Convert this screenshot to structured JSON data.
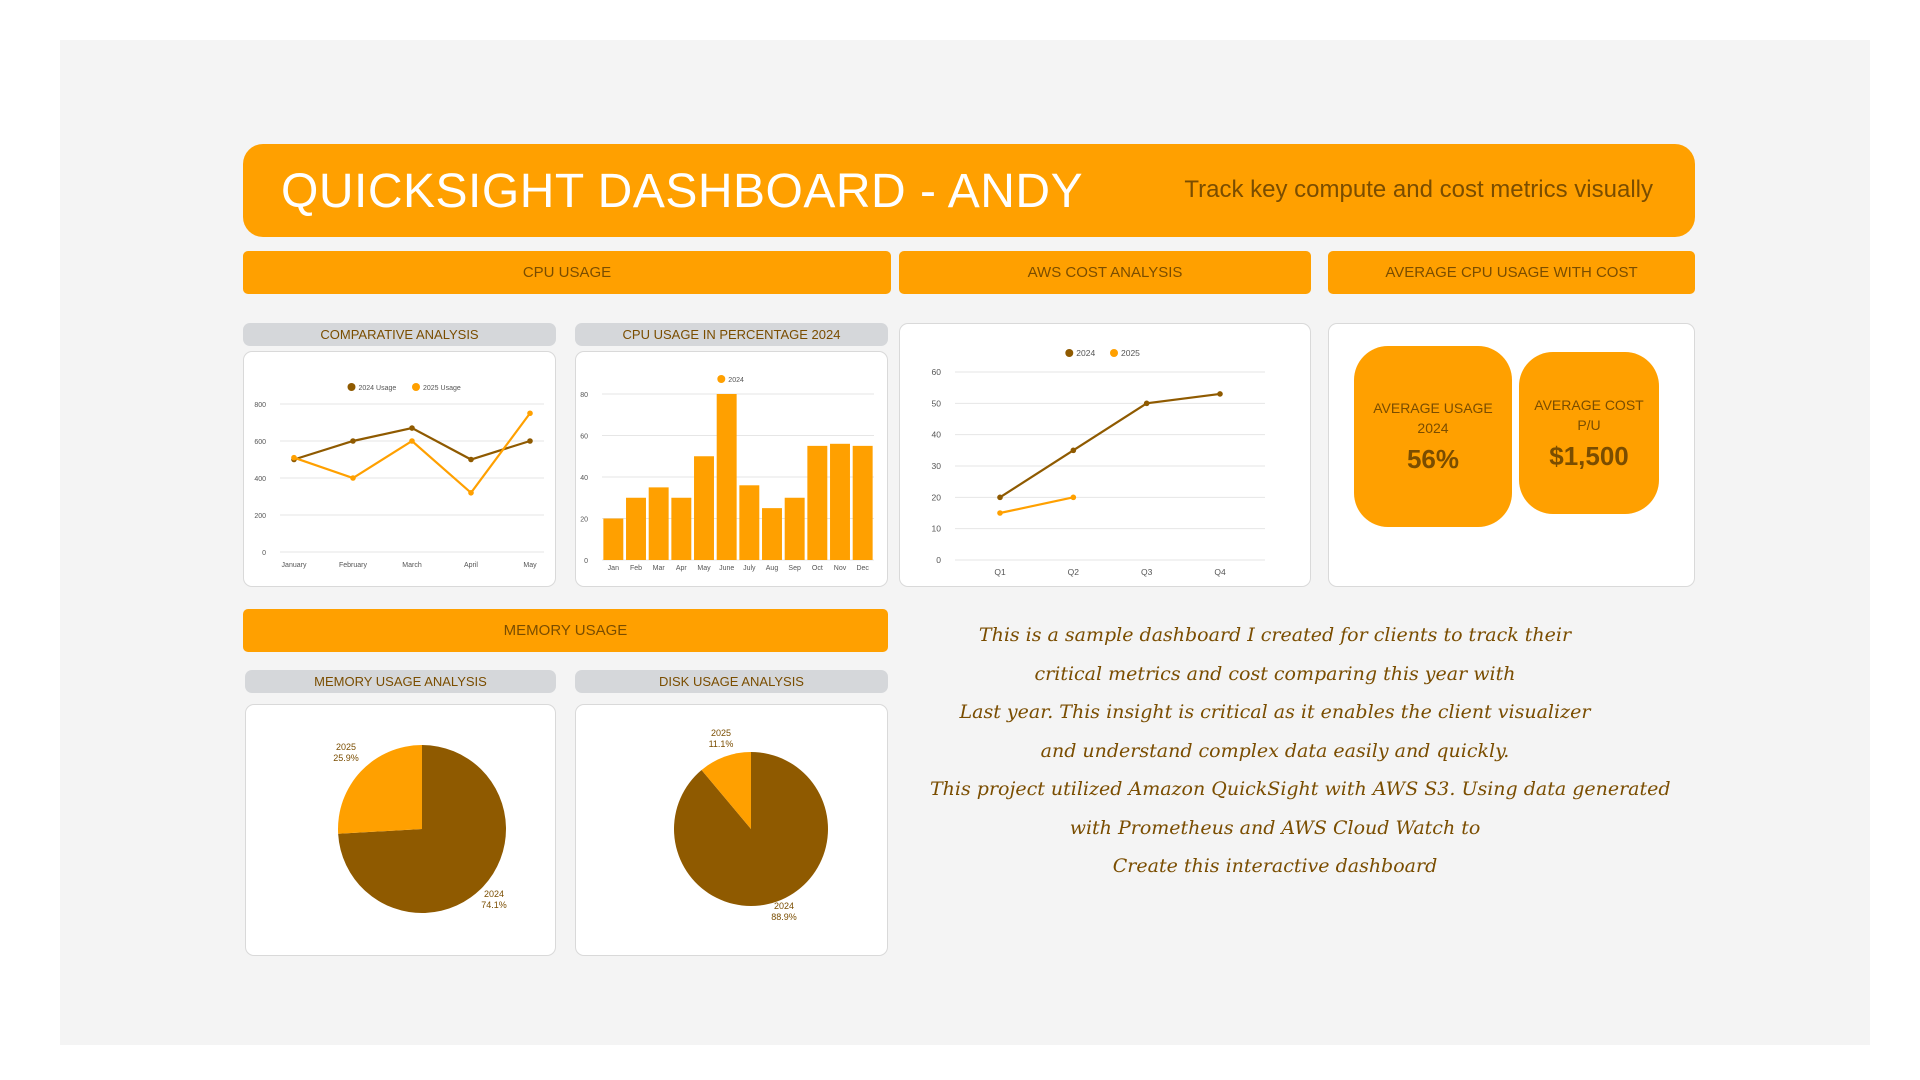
{
  "header": {
    "title": "QUICKSIGHT DASHBOARD - ANDY",
    "subtitle": "Track key compute and cost metrics visually"
  },
  "sections": {
    "cpu_usage": "CPU USAGE",
    "aws_cost": "AWS COST ANALYSIS",
    "avg_cpu_cost": "AVERAGE CPU USAGE WITH COST",
    "memory_usage": "MEMORY USAGE"
  },
  "tabs": {
    "comparative": "COMPARATIVE ANALYSIS",
    "cpu_percentage": "CPU USAGE IN PERCENTAGE 2024",
    "memory_analysis": "MEMORY USAGE ANALYSIS",
    "disk_analysis": "DISK USAGE ANALYSIS"
  },
  "stats": {
    "avg_usage_label": "AVERAGE USAGE 2024",
    "avg_usage_value": "56%",
    "avg_cost_label": "AVERAGE COST P/U",
    "avg_cost_value": "$1,500"
  },
  "note_lines": [
    "This is a sample dashboard I created for clients to track their",
    "critical metrics and cost comparing this year with",
    "Last year. This insight is critical as it enables the client visualizer",
    "and understand complex data easily and quickly.",
    "This project utilized Amazon QuickSight with AWS S3. Using data generated",
    "with Prometheus and AWS Cloud Watch to",
    "Create this interactive dashboard"
  ],
  "colors": {
    "accent": "#ffa000",
    "dark": "#8f5a00",
    "text": "#7a4d00",
    "grid": "#e6e6e6"
  },
  "chart_data": [
    {
      "id": "comparative",
      "type": "line",
      "categories": [
        "January",
        "February",
        "March",
        "April",
        "May"
      ],
      "series": [
        {
          "name": "2024 Usage",
          "values": [
            500,
            600,
            670,
            500,
            600
          ],
          "color": "#8f5a00"
        },
        {
          "name": "2025 Usage",
          "values": [
            510,
            400,
            600,
            320,
            750
          ],
          "color": "#ffa000"
        }
      ],
      "ylim": [
        0,
        800
      ],
      "yticks": [
        0,
        200,
        400,
        600,
        800
      ],
      "grid": true,
      "legend": "top"
    },
    {
      "id": "cpu_pct",
      "type": "bar",
      "categories": [
        "Jan",
        "Feb",
        "Mar",
        "Apr",
        "May",
        "June",
        "July",
        "Aug",
        "Sep",
        "Oct",
        "Nov",
        "Dec"
      ],
      "series": [
        {
          "name": "2024",
          "values": [
            20,
            30,
            35,
            30,
            50,
            80,
            36,
            25,
            30,
            55,
            56,
            55
          ],
          "color": "#ffa000"
        }
      ],
      "ylim": [
        0,
        80
      ],
      "yticks": [
        0,
        20,
        40,
        60,
        80
      ],
      "grid": true,
      "legend": "top"
    },
    {
      "id": "aws_cost",
      "type": "line",
      "categories": [
        "Q1",
        "Q2",
        "Q3",
        "Q4"
      ],
      "series": [
        {
          "name": "2024",
          "values": [
            20,
            35,
            50,
            53
          ],
          "color": "#8f5a00"
        },
        {
          "name": "2025",
          "values": [
            15,
            20,
            null,
            null
          ],
          "color": "#ffa000"
        }
      ],
      "ylim": [
        0,
        60
      ],
      "yticks": [
        0,
        10,
        20,
        30,
        40,
        50,
        60
      ],
      "grid": true,
      "legend": "top"
    },
    {
      "id": "memory_pie",
      "type": "pie",
      "slices": [
        {
          "label": "2024",
          "pct_label": "74.1%",
          "value": 74.1,
          "color": "#8f5a00"
        },
        {
          "label": "2025",
          "pct_label": "25.9%",
          "value": 25.9,
          "color": "#ffa000"
        }
      ]
    },
    {
      "id": "disk_pie",
      "type": "pie",
      "slices": [
        {
          "label": "2024",
          "pct_label": "88.9%",
          "value": 88.9,
          "color": "#8f5a00"
        },
        {
          "label": "2025",
          "pct_label": "11.1%",
          "value": 11.1,
          "color": "#ffa000"
        }
      ]
    }
  ]
}
